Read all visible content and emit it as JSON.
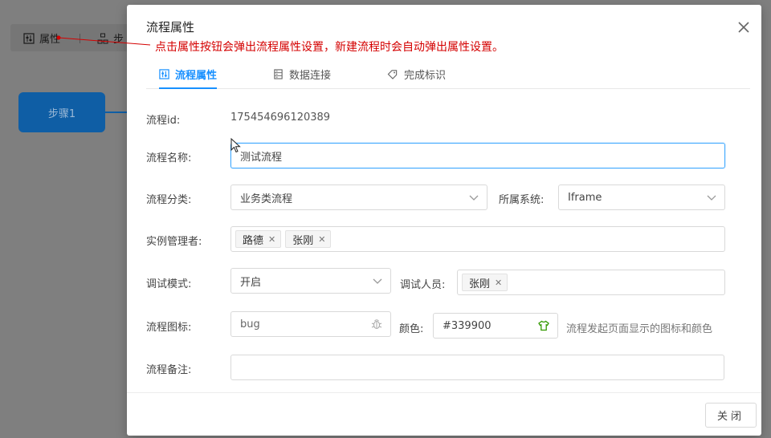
{
  "background": {
    "toolbar": {
      "attr_label": "属性",
      "step_label": "步"
    },
    "step_node": "步骤1"
  },
  "dialog": {
    "title": "流程属性",
    "tabs": [
      {
        "label": "流程属性",
        "icon": "sliders-icon",
        "active": true
      },
      {
        "label": "数据连接",
        "icon": "database-icon",
        "active": false
      },
      {
        "label": "完成标识",
        "icon": "tag-icon",
        "active": false
      }
    ],
    "fields": {
      "id_label": "流程id:",
      "id_value": "175454696120389",
      "name_label": "流程名称:",
      "name_value": "测试流程",
      "category_label": "流程分类:",
      "category_value": "业务类流程",
      "system_label": "所属系统:",
      "system_value": "Iframe",
      "managers_label": "实例管理者:",
      "managers": [
        "路德",
        "张刚"
      ],
      "debug_mode_label": "调试模式:",
      "debug_mode_value": "开启",
      "debug_users_label": "调试人员:",
      "debug_users": [
        "张刚"
      ],
      "icon_label": "流程图标:",
      "icon_value": "bug",
      "color_label": "颜色:",
      "color_value": "#339900",
      "icon_hint": "流程发起页面显示的图标和颜色",
      "remark_label": "流程备注:",
      "remark_value": ""
    },
    "close_button": "关闭"
  },
  "annotation": "点击属性按钮会弹出流程属性设置，新建流程时会自动弹出属性设置。",
  "colors": {
    "accent": "#1890ff",
    "annotation": "#d40000",
    "selected_color": "#339900",
    "step_node": "#0f5ea5"
  }
}
